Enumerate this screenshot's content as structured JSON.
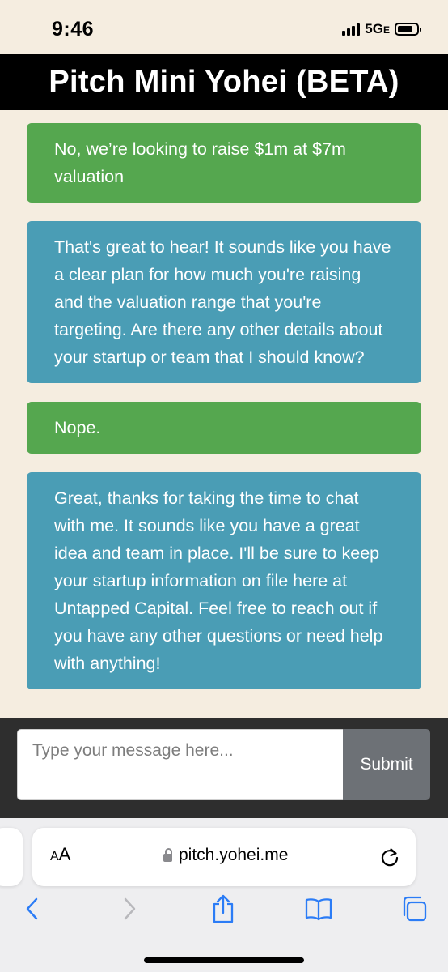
{
  "status": {
    "time": "9:46",
    "network": "5G",
    "network_suffix": "E"
  },
  "header": {
    "title": "Pitch Mini Yohei (BETA)"
  },
  "messages": [
    {
      "role": "user",
      "text": "No, we’re looking to raise $1m at $7m valuation"
    },
    {
      "role": "bot",
      "text": "That's great to hear! It sounds like you have a clear plan for how much you're raising and the valuation range that you're targeting. Are there any other details about your startup or team that I should know?"
    },
    {
      "role": "user",
      "text": "Nope."
    },
    {
      "role": "bot",
      "text": "Great, thanks for taking the time to chat with me. It sounds like you have a great idea and team in place. I'll be sure to keep your startup information on file here at Untapped Capital. Feel free to reach out if you have any other questions or need help with anything!"
    }
  ],
  "composer": {
    "placeholder": "Type your message here...",
    "submit_label": "Submit"
  },
  "browser": {
    "aa_label_small": "A",
    "aa_label": "A",
    "url": "pitch.yohei.me",
    "toolbar_icons": [
      "back-icon",
      "forward-icon",
      "share-icon",
      "bookmarks-icon",
      "tabs-icon"
    ]
  },
  "colors": {
    "user_bubble": "#55a74f",
    "bot_bubble": "#4a9db5",
    "page_bg": "#f5ede0",
    "header_bg": "#000000",
    "link_blue": "#2b7cf6"
  }
}
